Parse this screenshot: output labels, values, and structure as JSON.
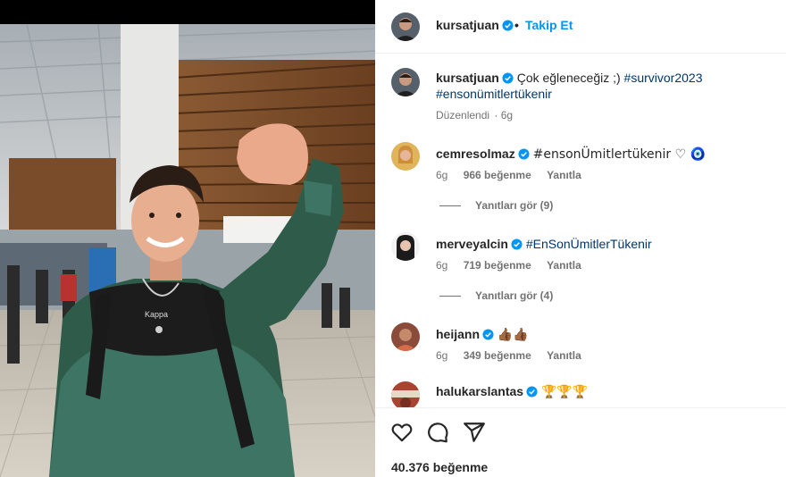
{
  "post": {
    "username": "kursatjuan",
    "dot": "•",
    "follow_label": "Takip Et",
    "caption": {
      "text": "Çok eğleneceğiz ;)",
      "tags": [
        "#survivor2023",
        "#ensonümitlertükenir"
      ],
      "edited": "Düzenlendi",
      "time": "6g"
    },
    "likes": "40.376 beğenme"
  },
  "comments": [
    {
      "username": "cemresolmaz",
      "text": "#ensonÜmitlertükenir ♡ 🧿",
      "time": "6g",
      "likes": "966 beğenme",
      "reply": "Yanıtla",
      "view_replies": "Yanıtları gör (9)"
    },
    {
      "username": "merveyalcin",
      "text": "#EnSonÜmitlerTükenir",
      "time": "6g",
      "likes": "719 beğenme",
      "reply": "Yanıtla",
      "view_replies": "Yanıtları gör (4)"
    },
    {
      "username": "heijann",
      "text": "👍🏾👍🏾",
      "time": "6g",
      "likes": "349 beğenme",
      "reply": "Yanıtla"
    },
    {
      "username": "halukarslantas",
      "text": "🏆🏆🏆"
    }
  ],
  "icons": {
    "like": "heart-icon",
    "comment": "comment-icon",
    "share": "share-icon",
    "verified": "verified-badge-icon"
  },
  "colors": {
    "accent": "#0095f6",
    "hashtag": "#00376b",
    "verified": "#0095f6",
    "muted": "#737373"
  }
}
